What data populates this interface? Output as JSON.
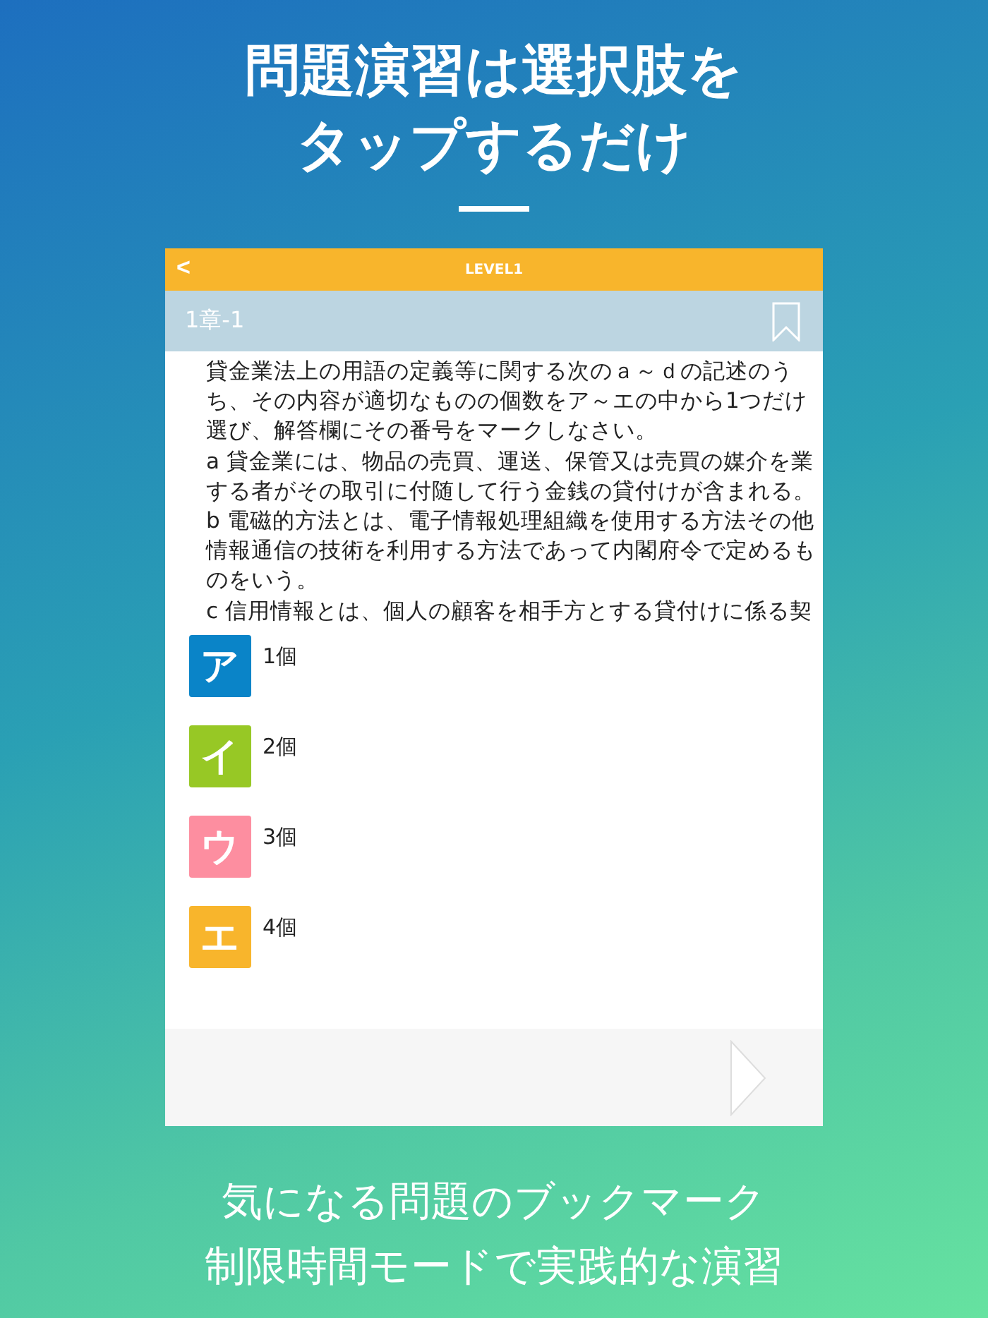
{
  "headline": [
    "問題演習は選択肢を",
    "タップするだけ"
  ],
  "screen": {
    "title": "LEVEL1",
    "back": "<",
    "question_number": "1章-1",
    "bookmarked": false,
    "question_lines": [
      "貸金業法上の用語の定義等に関する次のａ～ｄの記述のう",
      "ち、その内容が適切なものの個数をア～エの中から1つだけ",
      "選び、解答欄にその番号をマークしなさい。",
      "a 貸金業には、物品の売買、運送、保管又は売買の媒介を業",
      "する者がその取引に付随して行う金銭の貸付けが含まれる。",
      "b 電磁的方法とは、電子情報処理組織を使用する方法その他",
      "情報通信の技術を利用する方法であって内閣府令で定めるも",
      "のをいう。",
      "c 信用情報とは、個人の顧客を相手方とする貸付けに係る契"
    ],
    "choices": [
      {
        "mark": "ア",
        "text": "1個",
        "color": "#0a84c8"
      },
      {
        "mark": "イ",
        "text": "2個",
        "color": "#97c825"
      },
      {
        "mark": "ウ",
        "text": "3個",
        "color": "#fd8ea0"
      },
      {
        "mark": "エ",
        "text": "4個",
        "color": "#f8b52c"
      }
    ]
  },
  "caption": [
    "気になる問題のブックマーク",
    "制限時間モードで実践的な演習"
  ]
}
